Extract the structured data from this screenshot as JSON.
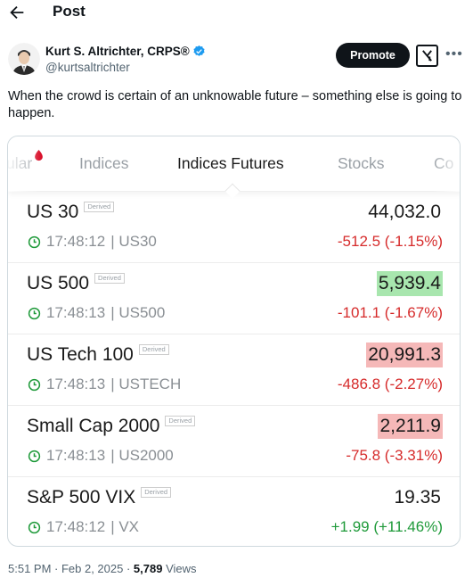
{
  "header": {
    "title": "Post"
  },
  "author": {
    "name": "Kurt S. Altrichter, CRPS®",
    "handle": "@kurtsaltrichter"
  },
  "actions": {
    "promote_label": "Promote"
  },
  "tweet": {
    "text": "When the crowd is certain of an unknowable future – something else is going to happen."
  },
  "card": {
    "tabs": [
      "ular",
      "Indices",
      "Indices Futures",
      "Stocks",
      "Co"
    ],
    "active_tab": "Indices Futures",
    "derived_label": "Derived",
    "rows": [
      {
        "name": "US 30",
        "price": "44,032.0",
        "time": "17:48:12",
        "symbol": "| US30",
        "change": "-512.5 (-1.15%)",
        "direction": "neg",
        "highlight": "none"
      },
      {
        "name": "US 500",
        "price": "5,939.4",
        "time": "17:48:13",
        "symbol": "| US500",
        "change": "-101.1 (-1.67%)",
        "direction": "neg",
        "highlight": "up"
      },
      {
        "name": "US Tech 100",
        "price": "20,991.3",
        "time": "17:48:13",
        "symbol": "| USTECH",
        "change": "-486.8 (-2.27%)",
        "direction": "neg",
        "highlight": "down"
      },
      {
        "name": "Small Cap 2000",
        "price": "2,211.9",
        "time": "17:48:13",
        "symbol": "| US2000",
        "change": "-75.8 (-3.31%)",
        "direction": "neg",
        "highlight": "down"
      },
      {
        "name": "S&P 500 VIX",
        "price": "19.35",
        "time": "17:48:12",
        "symbol": "| VX",
        "change": "+1.99 (+11.46%)",
        "direction": "pos",
        "highlight": "none"
      }
    ]
  },
  "footer": {
    "time": "5:51 PM · Feb 2, 2025 · ",
    "views": "5,789",
    "views_label": " Views"
  },
  "colors": {
    "accent": "#1d9bf0",
    "positive": "#1f9a3a",
    "negative": "#d62b2b",
    "up_flash": "#a8e6ae",
    "down_flash": "#f5b8b8"
  },
  "icons": {
    "back": "arrow-left-icon",
    "verified": "verified-badge-icon",
    "grok": "grok-icon",
    "more": "more-icon",
    "clock": "clock-icon"
  }
}
